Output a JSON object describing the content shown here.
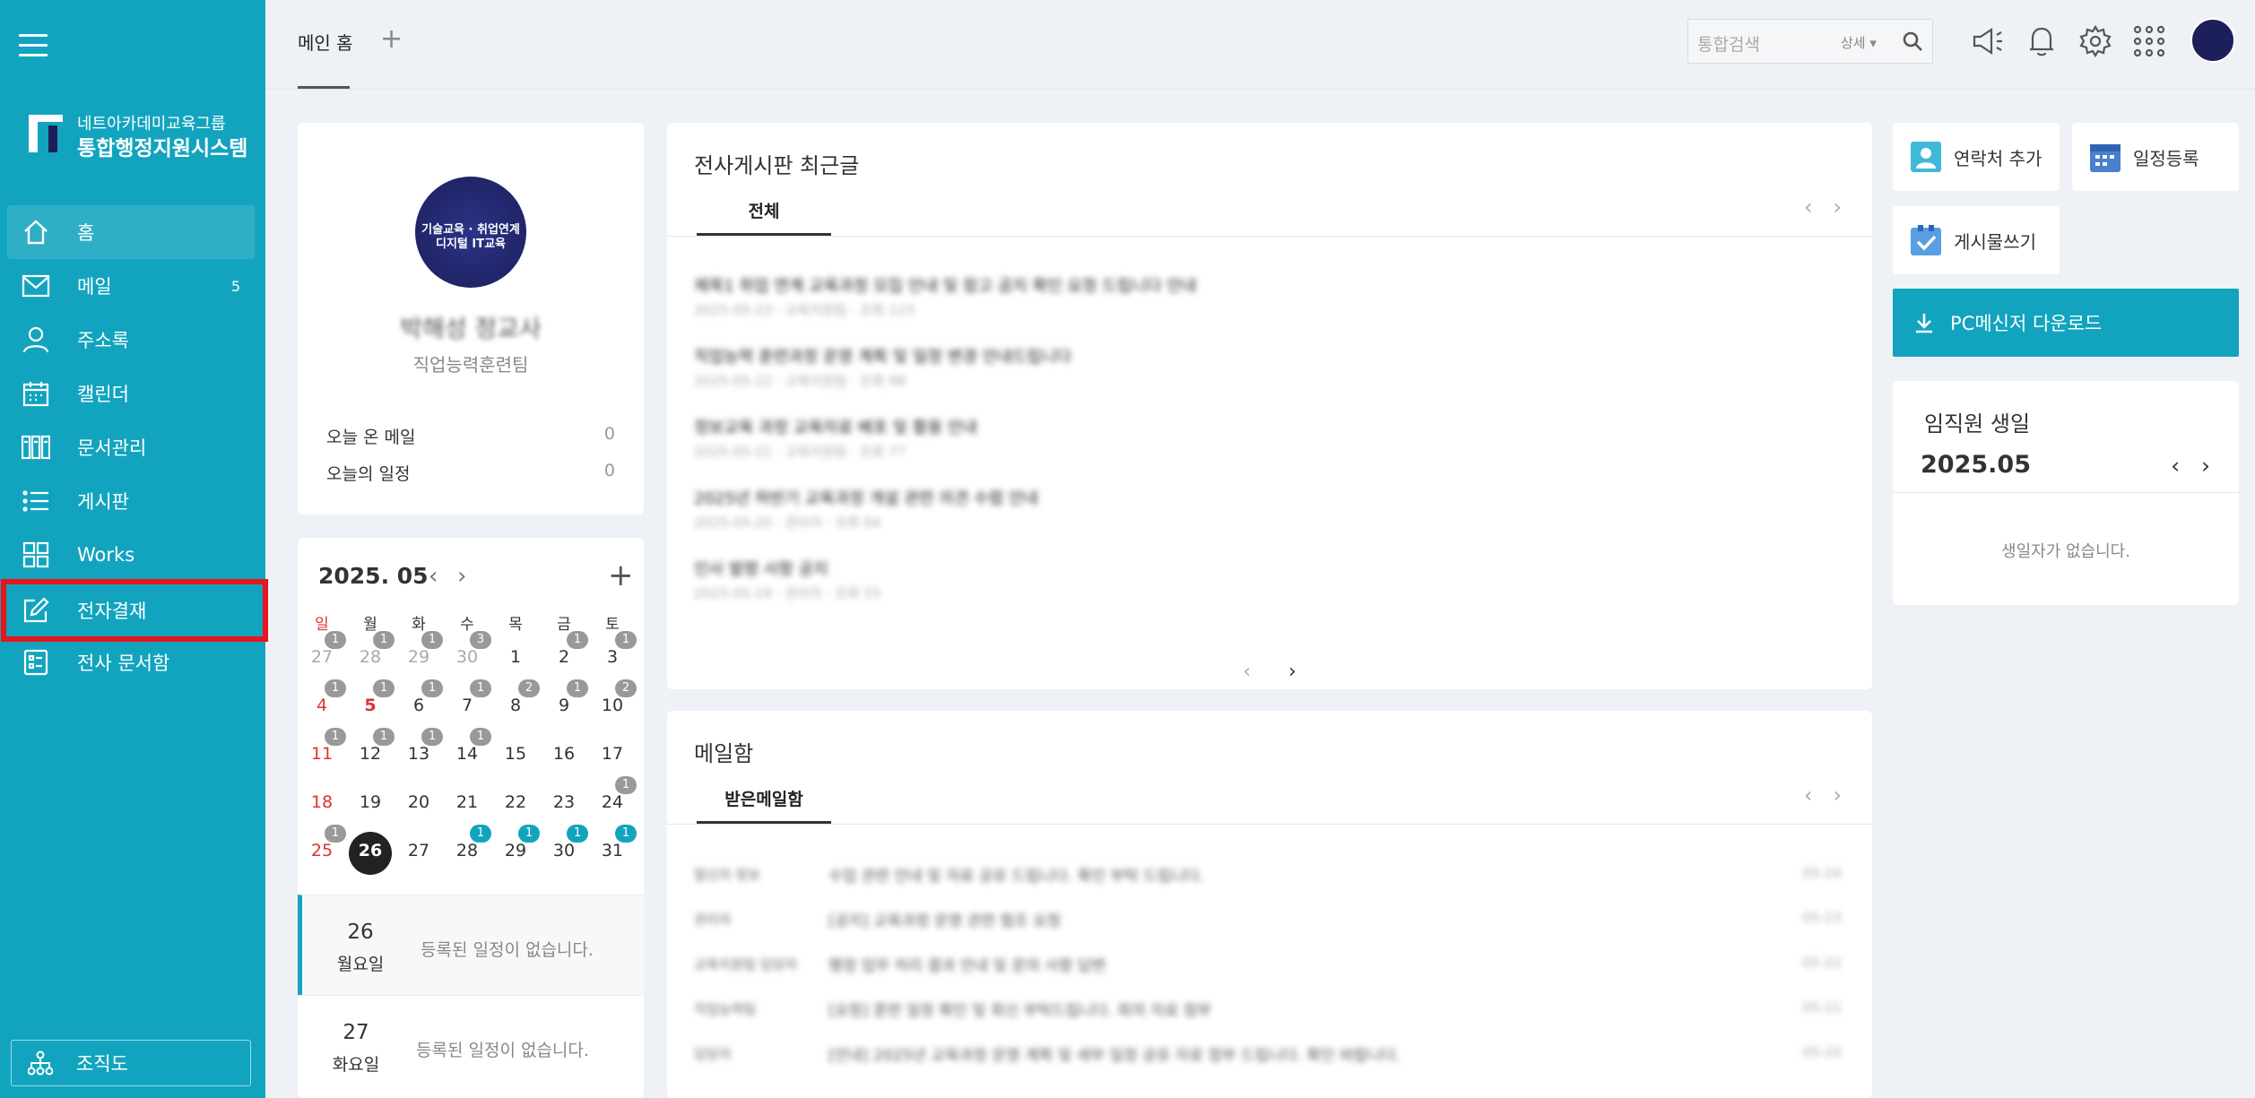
{
  "sidebar": {
    "logo": {
      "line1": "네트아카데미교육그룹",
      "line2": "통합행정지원시스템"
    },
    "items": [
      {
        "label": "홈",
        "icon": "home-icon"
      },
      {
        "label": "메일",
        "icon": "mail-icon",
        "badge": "5"
      },
      {
        "label": "주소록",
        "icon": "contacts-icon"
      },
      {
        "label": "캘린더",
        "icon": "calendar-icon"
      },
      {
        "label": "문서관리",
        "icon": "document-icon"
      },
      {
        "label": "게시판",
        "icon": "board-icon"
      },
      {
        "label": "Works",
        "icon": "works-icon"
      },
      {
        "label": "전자결재",
        "icon": "approval-icon"
      },
      {
        "label": "전사 문서함",
        "icon": "archive-icon"
      }
    ],
    "org_label": "조직도"
  },
  "topbar": {
    "tab": "메인 홈",
    "search_placeholder": "통합검색",
    "search_detail": "상세"
  },
  "profile": {
    "avatar_text_1": "기술교육 · 취업연계",
    "avatar_text_2": "디지털 IT교육",
    "name": "박해성 정교사",
    "team": "직업능력훈련팀",
    "today_mail_label": "오늘 온 메일",
    "today_mail_count": "0",
    "today_schedule_label": "오늘의 일정",
    "today_schedule_count": "0"
  },
  "calendar": {
    "title": "2025. 05",
    "weekdays": [
      "일",
      "월",
      "화",
      "수",
      "목",
      "금",
      "토"
    ],
    "weeks": [
      [
        [
          "27",
          "1"
        ],
        [
          "28",
          "1"
        ],
        [
          "29",
          "1"
        ],
        [
          "30",
          "3"
        ],
        [
          "1",
          ""
        ],
        [
          "2",
          "1"
        ],
        [
          "3",
          "1"
        ]
      ],
      [
        [
          "4",
          "1"
        ],
        [
          "5",
          "1"
        ],
        [
          "6",
          "1"
        ],
        [
          "7",
          "1"
        ],
        [
          "8",
          "2"
        ],
        [
          "9",
          "1"
        ],
        [
          "10",
          "2"
        ]
      ],
      [
        [
          "11",
          "1"
        ],
        [
          "12",
          "1"
        ],
        [
          "13",
          "1"
        ],
        [
          "14",
          "1"
        ],
        [
          "15",
          ""
        ],
        [
          "16",
          ""
        ],
        [
          "17",
          ""
        ]
      ],
      [
        [
          "18",
          ""
        ],
        [
          "19",
          ""
        ],
        [
          "20",
          ""
        ],
        [
          "21",
          ""
        ],
        [
          "22",
          ""
        ],
        [
          "23",
          ""
        ],
        [
          "24",
          "1"
        ]
      ],
      [
        [
          "25",
          "1"
        ],
        [
          "26",
          ""
        ],
        [
          "27",
          ""
        ],
        [
          "28",
          "1"
        ],
        [
          "29",
          "1"
        ],
        [
          "30",
          "1"
        ],
        [
          "31",
          "1"
        ]
      ]
    ],
    "schedule": [
      {
        "day": "26",
        "weekday": "월요일",
        "text": "등록된 일정이 없습니다."
      },
      {
        "day": "27",
        "weekday": "화요일",
        "text": "등록된 일정이 없습니다."
      }
    ]
  },
  "board": {
    "title": "전사게시판 최근글",
    "tab": "전체",
    "posts": [
      {
        "title": "제목1 취업 연계 교육과정 모집 안내 및 참고 공지 확인 요청 드립니다 안내",
        "meta": "2025-05-23 · 교육지원팀 · 조회 123"
      },
      {
        "title": "직업능력 훈련과정 운영 계획 및 일정 변경 안내드립니다",
        "meta": "2025-05-22 · 교육지원팀 · 조회 98"
      },
      {
        "title": "정보교육 과정 교육자료 배포 및 활용 안내",
        "meta": "2025-05-21 · 교육지원팀 · 조회 77"
      },
      {
        "title": "2025년 하반기 교육과정 개설 관련 의견 수렴 안내",
        "meta": "2025-05-20 · 관리자 · 조회 64"
      },
      {
        "title": "인사 발령 사항 공지",
        "meta": "2025-05-19 · 관리자 · 조회 55"
      }
    ]
  },
  "mail": {
    "title": "메일함",
    "tab": "받은메일함",
    "items": [
      {
        "from": "발신자 정보",
        "subject": "수업 관련 안내 및 자료 공유 드립니다. 확인 부탁 드립니다.",
        "time": "05-24"
      },
      {
        "from": "관리자",
        "subject": "[공지] 교육과정 운영 관련 협조 요청",
        "time": "05-23"
      },
      {
        "from": "교육지원팀 담당자",
        "subject": "행정 업무 처리 결과 안내 및 문의 사항 답변",
        "time": "05-22"
      },
      {
        "from": "직업능력팀",
        "subject": "[요청] 훈련 일정 확인 및 회신 부탁드립니다. 회의 자료 첨부",
        "time": "05-21"
      },
      {
        "from": "담당자",
        "subject": "[안내] 2025년 교육과정 운영 계획 및 세부 일정 공유 자료 첨부 드립니다. 확인 바랍니다.",
        "time": "05-20"
      }
    ]
  },
  "quick": {
    "add_contact": "연락처 추가",
    "add_schedule": "일정등록",
    "write_post": "게시물쓰기",
    "pc_messenger": "PC메신저 다운로드"
  },
  "birthday": {
    "title": "임직원 생일",
    "month": "2025.05",
    "empty": "생일자가 없습니다."
  },
  "colors": {
    "accent": "#12a4bf",
    "highlight": "#e8141e",
    "holiday": "#e03131"
  }
}
